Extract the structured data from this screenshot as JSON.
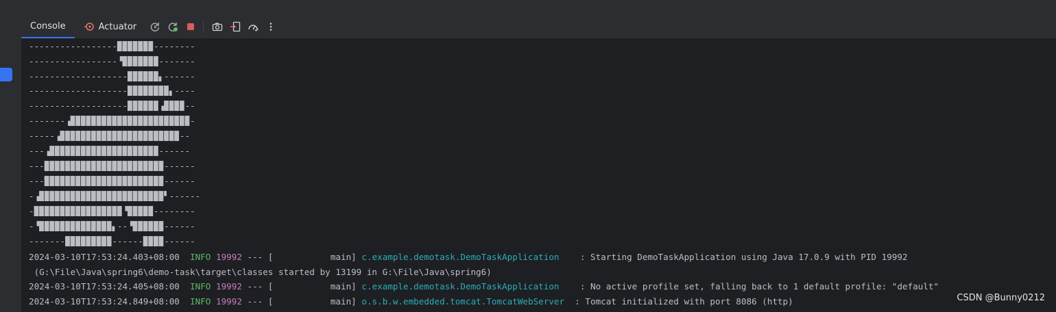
{
  "toolbar": {
    "tabs": [
      {
        "label": "Console",
        "active": true
      },
      {
        "label": "Actuator",
        "active": false
      }
    ],
    "buttons": [
      "rerun-icon",
      "rerun-failed-icon",
      "stop-icon",
      "screenshot-icon",
      "exit-icon",
      "profiler-icon",
      "more-options-icon"
    ]
  },
  "console": {
    "banner": [
      "-----------------▉▉▉▉▉▉▉--------",
      "-----------------▝▉▉▉▉▉▉▉-------",
      "-------------------▉▉▉▉▉▉▖------",
      "-------------------▉▉▉▉▉▉▉▉▖----",
      "-------------------▉▉▉▉▉▉▗▉▉▉▉--",
      "-------▗▉▉▉▉▉▉▉▉▉▉▉▉▉▉▉▉▉▉▉▉▉▉▉-",
      "-----▗▉▉▉▉▉▉▉▉▉▉▉▉▉▉▉▉▉▉▉▉▉▉▉--",
      "---▗▉▉▉▉▉▉▉▉▉▉▉▉▉▉▉▉▉▉▉▉▉------",
      "---▉▉▉▉▉▉▉▉▉▉▉▉▉▉▉▉▉▉▉▉▉▉▉------",
      "---▉▉▉▉▉▉▉▉▉▉▉▉▉▉▉▉▉▉▉▉▉▉▉------",
      "-▗▉▉▉▉▉▉▉▉▉▉▉▉▉▉▉▉▉▉▉▉▉▉▉▉▘------",
      "-▉▉▉▉▉▉▉▉▉▉▉▉▉▉▉▉▉▝▉▉▉▉▉--------",
      "-▝▉▉▉▉▉▉▉▉▉▉▉▉▉▉▖--▝▉▉▉▉▉▉------",
      "-------▉▉▉▉▉▉▉▉▉------▉▉▉▉------"
    ],
    "logs": [
      {
        "ts": "2024-03-10T17:53:24.403+08:00",
        "level": "INFO",
        "pid": "19992",
        "sep": "--- [",
        "thread": "main]",
        "logger": "c.example.demotask.DemoTaskApplication",
        "msg": ": Starting DemoTaskApplication using Java 17.0.9 with PID 19992"
      },
      {
        "cont": " (G:\\File\\Java\\spring6\\demo-task\\target\\classes started by 13199 in G:\\File\\Java\\spring6)"
      },
      {
        "ts": "2024-03-10T17:53:24.405+08:00",
        "level": "INFO",
        "pid": "19992",
        "sep": "--- [",
        "thread": "main]",
        "logger": "c.example.demotask.DemoTaskApplication",
        "msg": ": No active profile set, falling back to 1 default profile: \"default\""
      },
      {
        "ts": "2024-03-10T17:53:24.849+08:00",
        "level": "INFO",
        "pid": "19992",
        "sep": "--- [",
        "thread": "main]",
        "logger": "o.s.b.w.embedded.tomcat.TomcatWebServer",
        "msg": ": Tomcat initialized with port 8086 (http)"
      }
    ]
  },
  "watermark": "CSDN @Bunny0212"
}
